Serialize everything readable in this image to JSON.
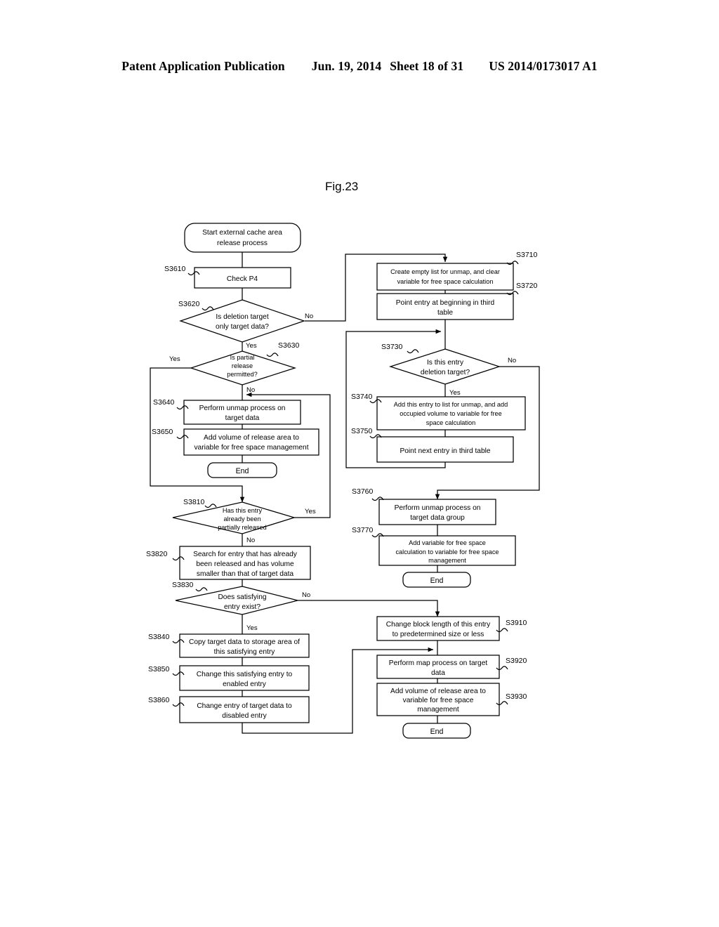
{
  "header": {
    "publication": "Patent Application Publication",
    "date": "Jun. 19, 2014",
    "sheet": "Sheet 18 of 31",
    "number": "US 2014/0173017 A1"
  },
  "figure": {
    "label": "Fig.23"
  },
  "flowchart": {
    "start": "Start external cache area release process",
    "nodes": {
      "s3610": {
        "id": "S3610",
        "text": "Check P4"
      },
      "s3620": {
        "id": "S3620",
        "text": "Is deletion target only target data?"
      },
      "s3630": {
        "id": "S3630",
        "text": "Is partial release permitted?"
      },
      "s3640": {
        "id": "S3640",
        "text": "Perform unmap process on target data"
      },
      "s3650": {
        "id": "S3650",
        "text": "Add volume of release area to variable for free space management"
      },
      "s3710": {
        "id": "S3710",
        "text": "Create empty list for unmap, and clear variable for free space calculation"
      },
      "s3720": {
        "id": "S3720",
        "text": "Point entry at beginning in third table"
      },
      "s3730": {
        "id": "S3730",
        "text": "Is this entry deletion target?"
      },
      "s3740": {
        "id": "S3740",
        "text": "Add this entry to list for unmap, and add occupied volume to variable for free space calculation"
      },
      "s3750": {
        "id": "S3750",
        "text": "Point next entry in third table"
      },
      "s3760": {
        "id": "S3760",
        "text": "Perform unmap process on target data group"
      },
      "s3770": {
        "id": "S3770",
        "text": "Add variable for free space calculation to variable for free space management"
      },
      "s3810": {
        "id": "S3810",
        "text": "Has this entry already been partially released"
      },
      "s3820": {
        "id": "S3820",
        "text": "Search for entry that has already been released and has volume smaller than that of target data"
      },
      "s3830": {
        "id": "S3830",
        "text": "Does satisfying entry exist?"
      },
      "s3840": {
        "id": "S3840",
        "text": "Copy target data to storage area of this satisfying entry"
      },
      "s3850": {
        "id": "S3850",
        "text": "Change this satisfying entry to enabled entry"
      },
      "s3860": {
        "id": "S3860",
        "text": "Change entry of target data to disabled entry"
      },
      "s3910": {
        "id": "S3910",
        "text": "Change block length of this entry to predetermined size or less"
      },
      "s3920": {
        "id": "S3920",
        "text": "Perform map process on target data"
      },
      "s3930": {
        "id": "S3930",
        "text": "Add volume of release area to variable for free space management"
      }
    },
    "lines": {
      "start_1": "Start external cache area",
      "start_2": "release process",
      "s3610_1": "Check P4",
      "s3620_1": "Is deletion target",
      "s3620_2": "only target data?",
      "s3630_1": "Is partial",
      "s3630_2": "release",
      "s3630_3": "permitted?",
      "s3640_1": "Perform unmap process on",
      "s3640_2": "target data",
      "s3650_1": "Add volume of release area to",
      "s3650_2": "variable for free space management",
      "s3710_1": "Create empty list for unmap, and clear",
      "s3710_2": "variable for free space calculation",
      "s3720_1": "Point entry at beginning in third",
      "s3720_2": "table",
      "s3730_1": "Is this entry",
      "s3730_2": "deletion target?",
      "s3740_1": "Add this entry to list for unmap, and add",
      "s3740_2": "occupied volume to variable for free",
      "s3740_3": "space calculation",
      "s3750_1": "Point next entry in third table",
      "s3760_1": "Perform unmap process on",
      "s3760_2": "target data group",
      "s3770_1": "Add variable for free space",
      "s3770_2": "calculation to variable for free space",
      "s3770_3": "management",
      "s3810_1": "Has this entry",
      "s3810_2": "already been",
      "s3810_3": "partially released",
      "s3820_1": "Search for entry that has already",
      "s3820_2": "been released and has volume",
      "s3820_3": "smaller than that of target data",
      "s3830_1": "Does satisfying",
      "s3830_2": "entry exist?",
      "s3840_1": "Copy target data to storage area of",
      "s3840_2": "this satisfying entry",
      "s3850_1": "Change this satisfying entry to",
      "s3850_2": "enabled entry",
      "s3860_1": "Change entry of target data to",
      "s3860_2": "disabled entry",
      "s3910_1": "Change block length of this entry",
      "s3910_2": "to predetermined size or less",
      "s3920_1": "Perform map process on target",
      "s3920_2": "data",
      "s3930_1": "Add volume of release area to",
      "s3930_2": "variable for free space",
      "s3930_3": "management"
    },
    "branches": {
      "yes": "Yes",
      "no": "No"
    },
    "terminals": {
      "end_left": "End",
      "end_right_mid": "End",
      "end_right_bottom": "End"
    },
    "step_ids": {
      "s3610": "S3610",
      "s3620": "S3620",
      "s3630": "S3630",
      "s3640": "S3640",
      "s3650": "S3650",
      "s3710": "S3710",
      "s3720": "S3720",
      "s3730": "S3730",
      "s3740": "S3740",
      "s3750": "S3750",
      "s3760": "S3760",
      "s3770": "S3770",
      "s3810": "S3810",
      "s3820": "S3820",
      "s3830": "S3830",
      "s3840": "S3840",
      "s3850": "S3850",
      "s3860": "S3860",
      "s3910": "S3910",
      "s3920": "S3920",
      "s3930": "S3930"
    },
    "colors": {
      "stroke": "#000000",
      "fill": "#ffffff",
      "text": "#000000"
    }
  }
}
